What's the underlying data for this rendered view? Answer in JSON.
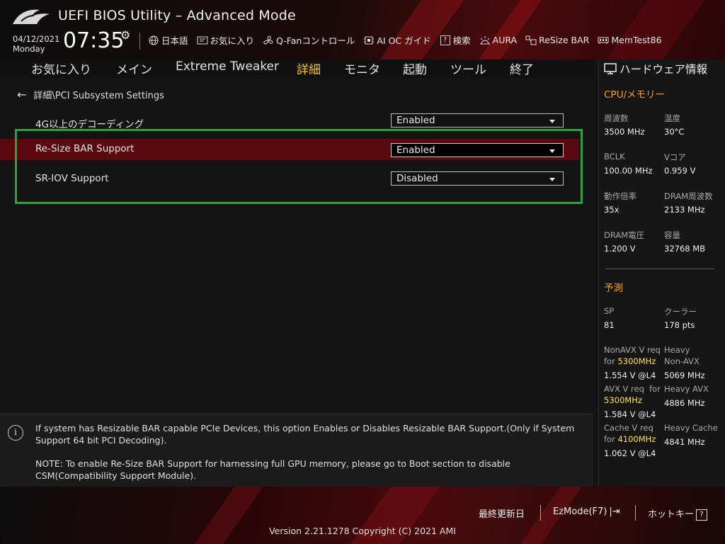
{
  "app": {
    "title": "UEFI BIOS Utility – Advanced Mode"
  },
  "clock": {
    "date": "04/12/2021",
    "day": "Monday",
    "time": "07:35"
  },
  "toolbar": [
    {
      "label": "日本語",
      "icon": "globe-icon"
    },
    {
      "label": "お気に入り",
      "icon": "favorites-icon"
    },
    {
      "label": "Q-Fanコントロール",
      "icon": "fan-icon"
    },
    {
      "label": "AI OC ガイド",
      "icon": "ai-oc-icon"
    },
    {
      "label": "検索",
      "icon": "search-icon"
    },
    {
      "label": "AURA",
      "icon": "aura-icon"
    },
    {
      "label": "ReSize BAR",
      "icon": "resize-bar-icon"
    },
    {
      "label": "MemTest86",
      "icon": "memtest-icon"
    }
  ],
  "tabs": [
    {
      "label": "お気に入り",
      "active": false
    },
    {
      "label": "メイン",
      "active": false
    },
    {
      "label": "Extreme Tweaker",
      "active": false
    },
    {
      "label": "詳細",
      "active": true
    },
    {
      "label": "モニタ",
      "active": false
    },
    {
      "label": "起動",
      "active": false
    },
    {
      "label": "ツール",
      "active": false
    },
    {
      "label": "終了",
      "active": false
    }
  ],
  "breadcrumb": "詳細\\PCI Subsystem Settings",
  "settings": [
    {
      "label": "4G以上のデコーディング",
      "value": "Enabled",
      "selected": false
    },
    {
      "label": "Re-Size BAR Support",
      "value": "Enabled",
      "selected": true
    },
    {
      "label": "SR-IOV Support",
      "value": "Disabled",
      "selected": false
    }
  ],
  "help": {
    "line1": "If system has Resizable BAR capable PCIe Devices, this option Enables or Disables Resizable BAR Support.(Only if System Support 64 bit PCI Decoding).",
    "line2": "NOTE: To enable Re-Size BAR Support for harnessing full GPU memory, please go to Boot section to disable CSM(Compatibility Support Module)."
  },
  "hardware": {
    "title": "ハードウェア情報",
    "cpu_mem": {
      "title": "CPU/メモリー",
      "items": [
        {
          "label": "周波数",
          "value": "3500 MHz"
        },
        {
          "label": "温度",
          "value": "30°C"
        },
        {
          "label": "BCLK",
          "value": "100.00 MHz"
        },
        {
          "label": "Vコア",
          "value": "0.959 V"
        },
        {
          "label": "動作倍率",
          "value": "35x"
        },
        {
          "label": "DRAM周波数",
          "value": "2133 MHz"
        },
        {
          "label": "DRAM電圧",
          "value": "1.200 V"
        },
        {
          "label": "容量",
          "value": "32768 MB"
        }
      ]
    },
    "prediction": {
      "title": "予測",
      "sp_label": "SP",
      "sp_value": "81",
      "cooler_label": "クーラー",
      "cooler_value": "178 pts",
      "nonavx_label": "NonAVX V req",
      "nonavx_for": "for",
      "nonavx_freq": "5300MHz",
      "nonavx_value": "1.554 V @L4",
      "heavy_nonavx_label1": "Heavy",
      "heavy_nonavx_label2": "Non-AVX",
      "heavy_nonavx_value": "5069 MHz",
      "avx_label": "AVX V req",
      "avx_for": "for",
      "avx_freq": "5300MHz",
      "avx_value": "1.584 V @L4",
      "heavy_avx_label": "Heavy AVX",
      "heavy_avx_value": "4886 MHz",
      "cache_label": "Cache V req",
      "cache_for": "for",
      "cache_freq": "4100MHz",
      "cache_value": "1.062 V @L4",
      "heavy_cache_label": "Heavy Cache",
      "heavy_cache_value": "4841 MHz"
    }
  },
  "footer": {
    "last_modified": "最終更新日",
    "ezmode": "EzMode(F7)",
    "hotkeys": "ホットキー",
    "hotkeys_key": "?",
    "version": "Version 2.21.1278 Copyright (C) 2021 AMI"
  },
  "colors": {
    "accent": "#f5c518",
    "section": "#f0a020",
    "highlight_box": "#2ea043",
    "selected_row": "#5a0a0e"
  }
}
